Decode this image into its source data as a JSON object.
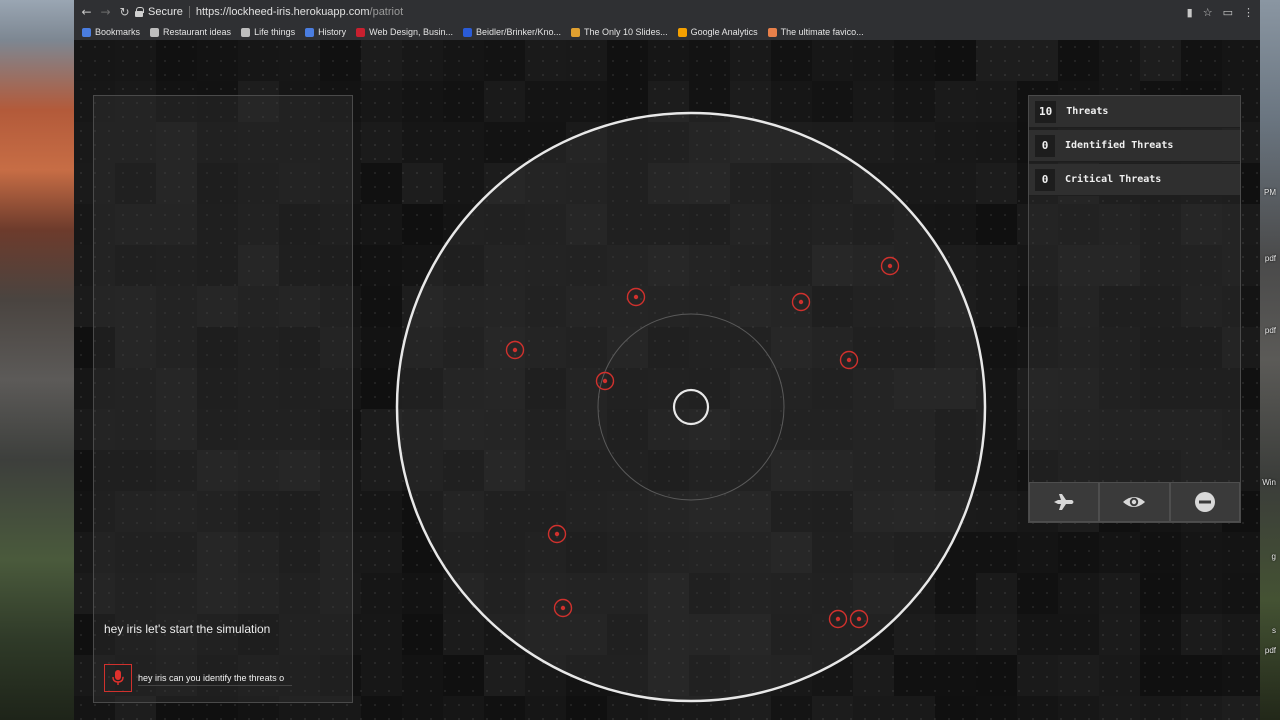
{
  "browser": {
    "secure_label": "Secure",
    "url_host": "https://lockheed-iris.herokuapp.com",
    "url_path": "/patriot",
    "bookmarks": [
      {
        "label": "Bookmarks",
        "color": "#4a7de0"
      },
      {
        "label": "Restaurant ideas",
        "color": "#bdbdbd"
      },
      {
        "label": "Life things",
        "color": "#bdbdbd"
      },
      {
        "label": "History",
        "color": "#4a7de0"
      },
      {
        "label": "Web Design, Busin...",
        "color": "#c8202f"
      },
      {
        "label": "Beidler/Brinker/Kno...",
        "color": "#2a5bd7"
      },
      {
        "label": "The Only 10 Slides...",
        "color": "#e0a030"
      },
      {
        "label": "Google Analytics",
        "color": "#f4a000"
      },
      {
        "label": "The ultimate favico...",
        "color": "#e8804a"
      }
    ]
  },
  "desktop": {
    "edge_labels": [
      "PM",
      "pdf",
      "pdf",
      "Win",
      "g",
      "s",
      "pdf"
    ]
  },
  "conversation": {
    "message": "hey iris let's start the simulation",
    "input_value": "hey iris can you identify the threats o"
  },
  "stats": [
    {
      "count": "10",
      "label": "Threats"
    },
    {
      "count": "0",
      "label": "Identified Threats"
    },
    {
      "count": "0",
      "label": "Critical Threats"
    }
  ],
  "actions": [
    {
      "icon": "jet-icon"
    },
    {
      "icon": "eye-icon"
    },
    {
      "icon": "minus-circle-icon"
    }
  ],
  "radar": {
    "threat_color": "#d0312d",
    "threat_count": 10
  }
}
